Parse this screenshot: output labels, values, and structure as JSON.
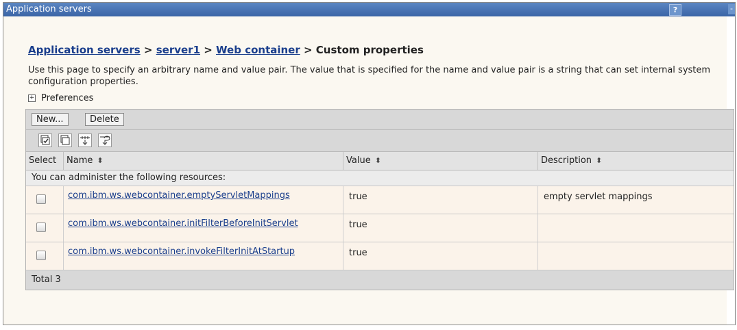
{
  "window": {
    "title": "Application servers",
    "help_label": "?",
    "min_label": "-"
  },
  "breadcrumb": {
    "items": [
      "Application servers",
      "server1",
      "Web container"
    ],
    "separator": ">",
    "current": "Custom properties"
  },
  "description": "Use this page to specify an arbitrary name and value pair. The value that is specified for the name and value pair is a string that can set internal system configuration properties.",
  "preferences": {
    "expand_glyph": "+",
    "label": "Preferences"
  },
  "toolbar": {
    "new_label": "New...",
    "delete_label": "Delete",
    "icons": [
      "select-all-icon",
      "deselect-all-icon",
      "show-filter-icon",
      "clear-filter-icon"
    ]
  },
  "table": {
    "columns": [
      "Select",
      "Name",
      "Value",
      "Description"
    ],
    "sort_glyph": "⬍",
    "admin_text": "You can administer the following resources:",
    "rows": [
      {
        "name": "com.ibm.ws.webcontainer.emptyServletMappings",
        "value": "true",
        "description": "empty servlet mappings"
      },
      {
        "name": "com.ibm.ws.webcontainer.initFilterBeforeInitServlet",
        "value": "true",
        "description": ""
      },
      {
        "name": "com.ibm.ws.webcontainer.invokeFilterInitAtStartup",
        "value": "true",
        "description": ""
      }
    ],
    "total": "Total 3"
  }
}
